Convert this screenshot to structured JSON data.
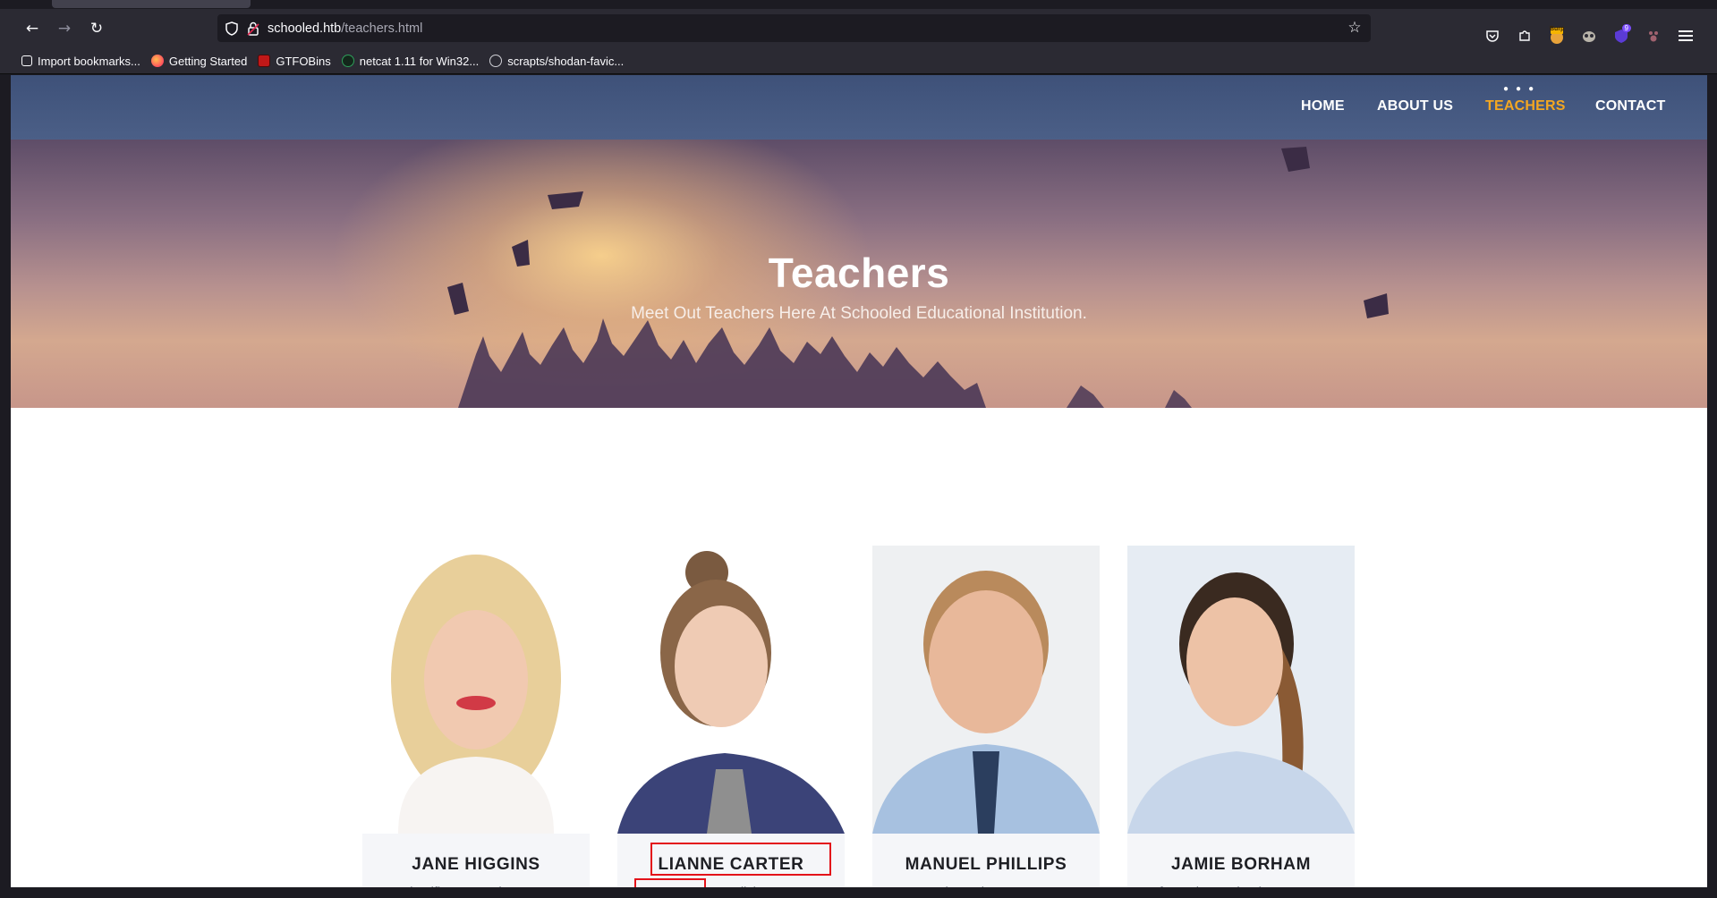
{
  "browser": {
    "url_host": "schooled.htb",
    "url_path": "/teachers.html",
    "bookmarks": [
      {
        "label": "Import bookmarks...",
        "icon": "import-icon",
        "color": "#fbfbfe"
      },
      {
        "label": "Getting Started",
        "icon": "firefox-icon",
        "color": "#ff7139"
      },
      {
        "label": "GTFOBins",
        "icon": "gtfobins-icon",
        "color": "#c01818"
      },
      {
        "label": "netcat 1.11 for Win32...",
        "icon": "netcat-icon",
        "color": "#2e9e5a"
      },
      {
        "label": "scrapts/shodan-favic...",
        "icon": "github-icon",
        "color": "#ffffff"
      }
    ],
    "extensions": {
      "burp_badge": "Burp",
      "notification_count": "9"
    }
  },
  "site": {
    "nav": {
      "items": [
        {
          "label": "HOME",
          "active": false
        },
        {
          "label": "ABOUT US",
          "active": false
        },
        {
          "label": "TEACHERS",
          "active": true
        },
        {
          "label": "CONTACT",
          "active": false
        }
      ],
      "accent_color": "#f4a721"
    },
    "hero": {
      "title": "Teachers",
      "subtitle": "Meet Out Teachers Here At Schooled Educational Institution."
    },
    "teachers": [
      {
        "name": "JANE HIGGINS",
        "role": "Scientific Research Lecturer"
      },
      {
        "name": "LIANNE CARTER",
        "role": "Manager & English Lecturer"
      },
      {
        "name": "MANUEL PHILLIPS",
        "role": "Mathematics Lecturer"
      },
      {
        "name": "JAMIE BORHAM",
        "role": "Information Technology Lecturer"
      }
    ]
  },
  "annotations": {
    "highlight_color": "#e3121a"
  }
}
